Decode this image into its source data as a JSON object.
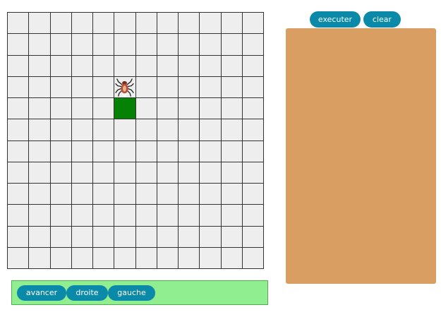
{
  "board": {
    "columns": 12,
    "rows": 12,
    "spider": {
      "row": 3,
      "col": 5,
      "facing": "up"
    },
    "goal": {
      "row": 4,
      "col": 5
    },
    "colors": {
      "cell": "#eeeeee",
      "line": "#333333",
      "goal": "#058205"
    }
  },
  "toolbar": {
    "execute_label": "executer",
    "clear_label": "clear"
  },
  "program_area": {
    "color": "#d99f62"
  },
  "palette": {
    "color": "#90ee90",
    "blocks": [
      "avancer",
      "droite",
      "gauche"
    ]
  },
  "accent_color": "#0a8aa8"
}
